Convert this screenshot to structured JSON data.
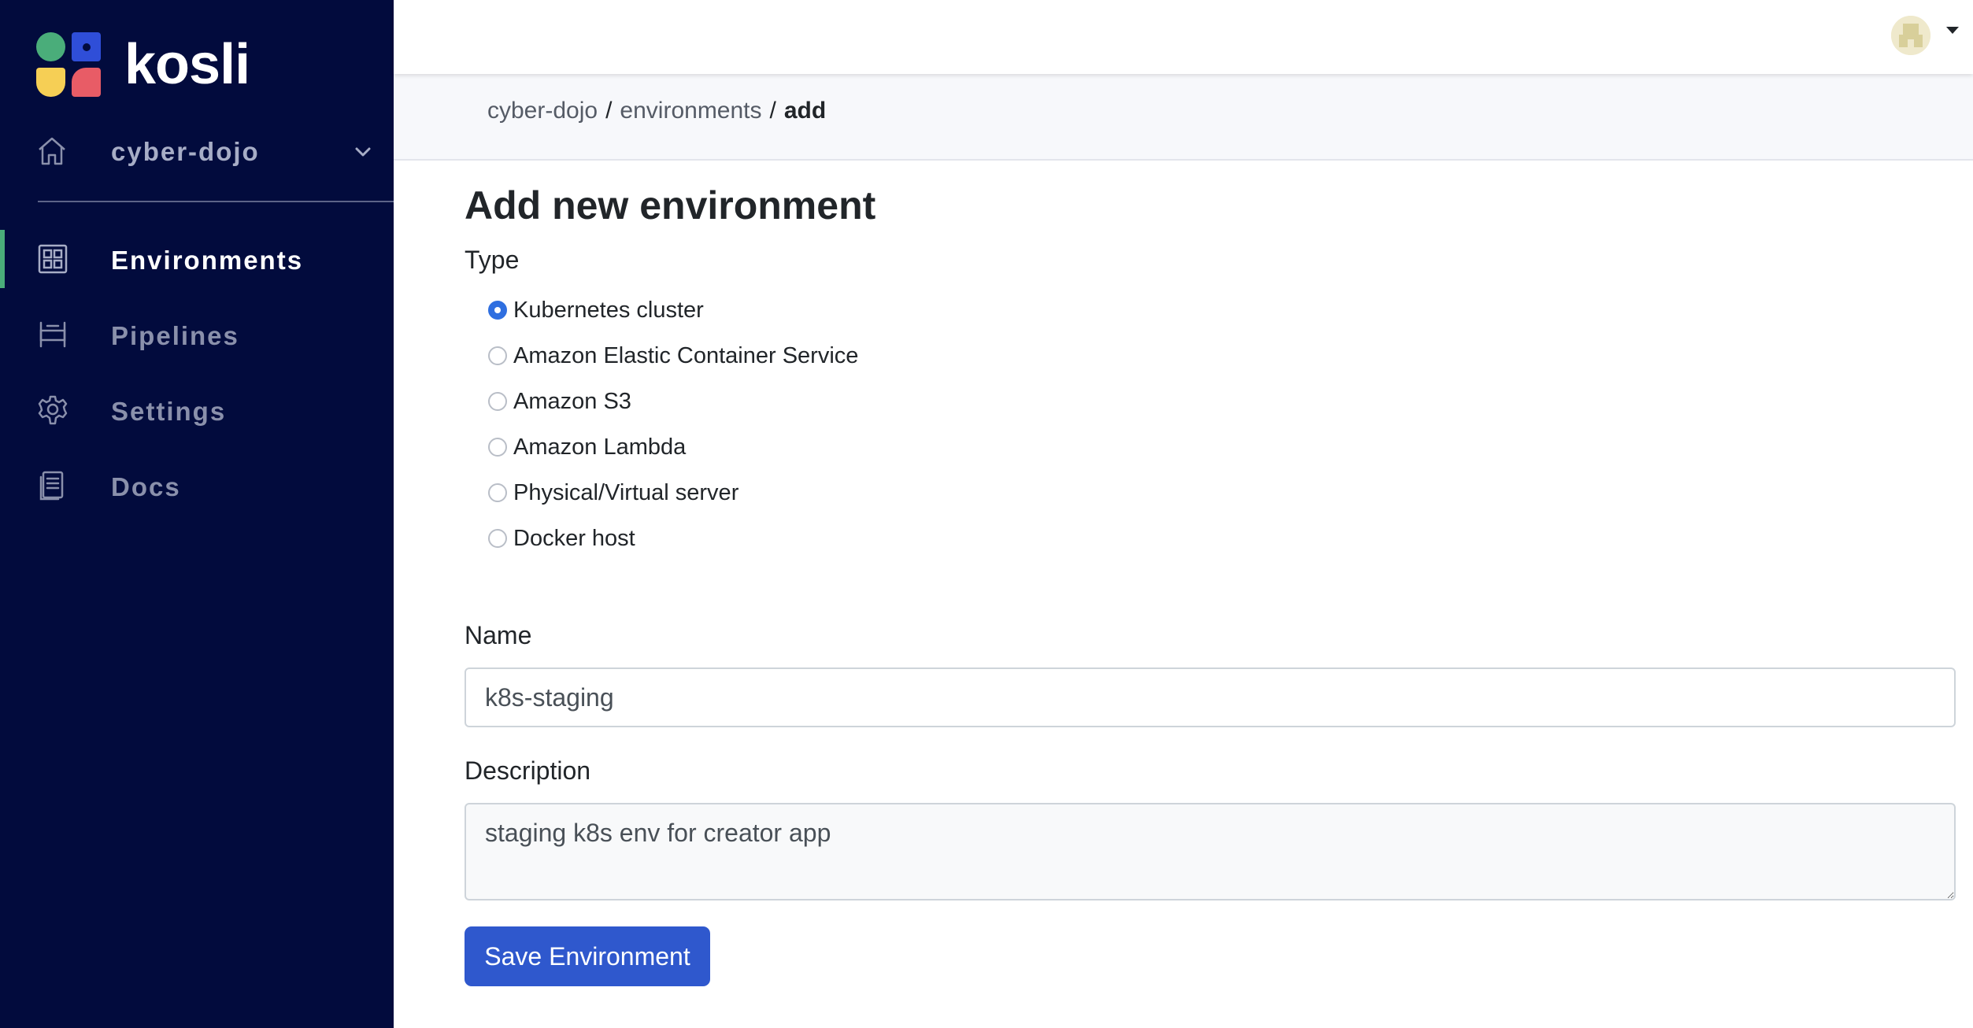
{
  "app": {
    "logo_text": "kosli",
    "brand_color": "#020b3d",
    "accent_color": "#4aad7a"
  },
  "sidebar": {
    "org": {
      "name": "cyber-dojo",
      "icon": "home-icon",
      "chevron_icon": "chevron-down-icon"
    },
    "items": [
      {
        "label": "Environments",
        "icon": "grid-icon",
        "active": true
      },
      {
        "label": "Pipelines",
        "icon": "pipeline-icon",
        "active": false
      },
      {
        "label": "Settings",
        "icon": "gear-icon",
        "active": false
      },
      {
        "label": "Docs",
        "icon": "document-icon",
        "active": false
      }
    ]
  },
  "topbar": {
    "avatar_icon": "user-avatar-icon",
    "menu_icon": "caret-down-icon"
  },
  "breadcrumb": {
    "org": "cyber-dojo",
    "section": "environments",
    "current": "add",
    "separator": "/"
  },
  "form": {
    "title": "Add new environment",
    "type_label": "Type",
    "type_options": [
      {
        "label": "Kubernetes cluster",
        "checked": true
      },
      {
        "label": "Amazon Elastic Container Service",
        "checked": false
      },
      {
        "label": "Amazon S3",
        "checked": false
      },
      {
        "label": "Amazon Lambda",
        "checked": false
      },
      {
        "label": "Physical/Virtual server",
        "checked": false
      },
      {
        "label": "Docker host",
        "checked": false
      }
    ],
    "name_label": "Name",
    "name_value": "k8s-staging",
    "description_label": "Description",
    "description_value": "staging k8s env for creator app",
    "submit_label": "Save Environment",
    "submit_color": "#2f58cd"
  }
}
